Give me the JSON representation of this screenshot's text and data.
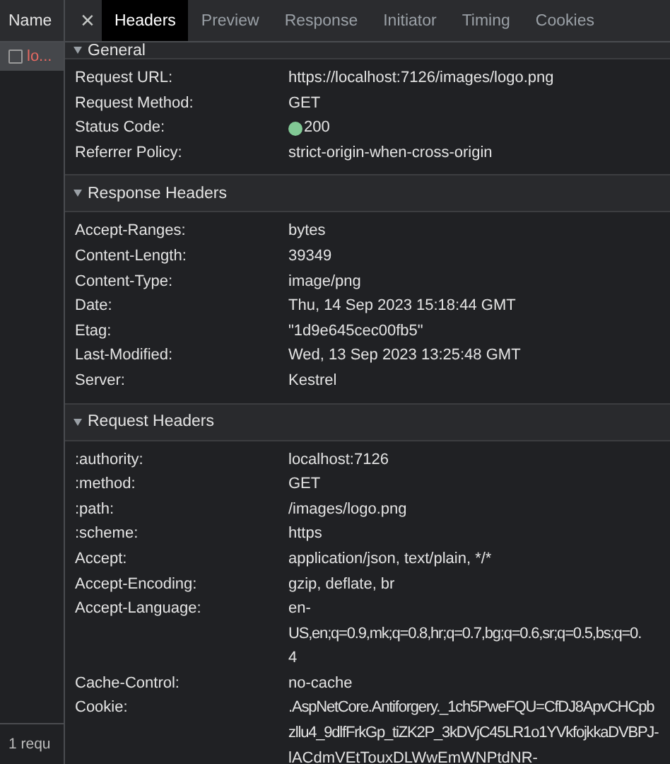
{
  "sidebar": {
    "column": "Name",
    "requests": [
      {
        "name": "lo...",
        "selected": true,
        "checked": false
      }
    ],
    "status_bar": "1 requ"
  },
  "tabs": [
    {
      "label": "Headers",
      "selected": true
    },
    {
      "label": "Preview",
      "selected": false
    },
    {
      "label": "Response",
      "selected": false
    },
    {
      "label": "Initiator",
      "selected": false
    },
    {
      "label": "Timing",
      "selected": false
    },
    {
      "label": "Cookies",
      "selected": false
    }
  ],
  "close_icon": "×",
  "sections": [
    {
      "title": "General",
      "expanded": true,
      "rows": [
        {
          "name": "Request URL:",
          "value": [
            "https://localhost:7126/images/logo.png"
          ]
        },
        {
          "name": "Request Method:",
          "value": [
            "GET"
          ]
        },
        {
          "name": "Status Code:",
          "kind": "status",
          "value": [
            "200"
          ]
        },
        {
          "name": "Referrer Policy:",
          "value": [
            "strict-origin-when-cross-origin"
          ]
        }
      ]
    },
    {
      "title": "Response Headers",
      "expanded": true,
      "rows": [
        {
          "name": "Accept-Ranges:",
          "value": [
            "bytes"
          ]
        },
        {
          "name": "Content-Length:",
          "value": [
            "39349"
          ]
        },
        {
          "name": "Content-Type:",
          "value": [
            "image/png"
          ]
        },
        {
          "name": "Date:",
          "value": [
            "Thu, 14 Sep 2023 15:18:44 GMT"
          ]
        },
        {
          "name": "Etag:",
          "value": [
            "\"1d9e645cec00fb5\""
          ]
        },
        {
          "name": "Last-Modified:",
          "value": [
            "Wed, 13 Sep 2023 13:25:48 GMT"
          ]
        },
        {
          "name": "Server:",
          "value": [
            "Kestrel"
          ]
        }
      ]
    },
    {
      "title": "Request Headers",
      "expanded": true,
      "rows": [
        {
          "name": ":authority:",
          "value": [
            "localhost:7126"
          ]
        },
        {
          "name": ":method:",
          "value": [
            "GET"
          ]
        },
        {
          "name": ":path:",
          "value": [
            "/images/logo.png"
          ]
        },
        {
          "name": ":scheme:",
          "value": [
            "https"
          ]
        },
        {
          "name": "Accept:",
          "value": [
            "application/json, text/plain, */*"
          ]
        },
        {
          "name": "Accept-Encoding:",
          "value": [
            "gzip, deflate, br"
          ]
        },
        {
          "name": "Accept-Language:",
          "value": [
            "en-",
            "US,en;q=0.9,mk;q=0.8,hr;q=0.7,bg;q=0.6,sr;q=0.5,bs;q=0.",
            "4"
          ]
        },
        {
          "name": "Cache-Control:",
          "value": [
            "no-cache"
          ]
        },
        {
          "name": "Cookie:",
          "value": [
            ".AspNetCore.Antiforgery._1ch5PweFQU=CfDJ8ApvCHCpb",
            "zllu4_9dlfFrkGp_tiZK2P_3kDVjC45LR1o1YVkfojkkaDVBPJ-",
            "lACdmVEtTouxDLWwEmWNPtdNR-"
          ]
        }
      ]
    }
  ]
}
